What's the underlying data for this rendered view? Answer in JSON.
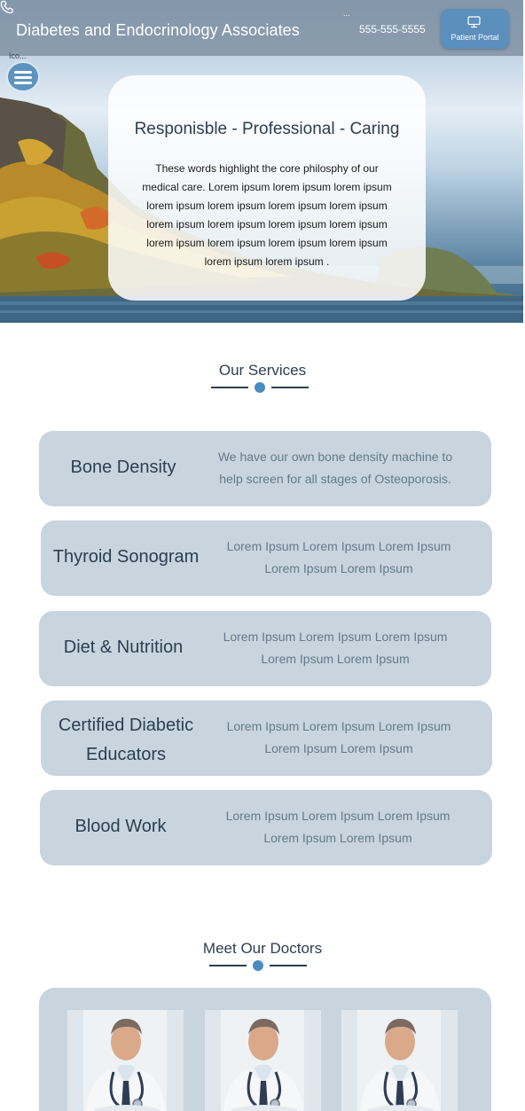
{
  "header": {
    "site_title": "Diabetes and Endocrinology Associates",
    "phone_dots": "...",
    "phone_icon": "phone-icon",
    "phone": "555-555-5555",
    "portal_dots": "...",
    "portal_icon": "monitor-icon",
    "portal_label": "Patient Portal",
    "icon_label": "Ico...",
    "menu_icon": "hamburger-menu-icon"
  },
  "hero": {
    "heading": "Responisble - Professional - Caring",
    "text": "These words highlight the core philosphy of our medical care.  Lorem ipsum lorem ipsum lorem ipsum lorem ipsum lorem ipsum lorem ipsum lorem ipsum lorem ipsum lorem ipsum lorem ipsum lorem ipsum lorem ipsum lorem ipsum lorem ipsum lorem ipsum lorem ipsum lorem ipsum ."
  },
  "services": {
    "title": "Our Services",
    "items": [
      {
        "name": "Bone Density",
        "desc": "We have our own bone density machine to help screen for all stages of Osteoporosis."
      },
      {
        "name": "Thyroid Sonogram",
        "desc": "Lorem Ipsum Lorem Ipsum Lorem Ipsum Lorem Ipsum Lorem Ipsum"
      },
      {
        "name": "Diet & Nutrition",
        "desc": "Lorem Ipsum Lorem Ipsum Lorem Ipsum Lorem Ipsum Lorem Ipsum"
      },
      {
        "name": "Certified Diabetic Educators",
        "desc": "Lorem Ipsum Lorem Ipsum Lorem Ipsum Lorem Ipsum Lorem Ipsum"
      },
      {
        "name": "Blood Work",
        "desc": "Lorem Ipsum Lorem Ipsum Lorem Ipsum Lorem Ipsum Lorem Ipsum"
      }
    ]
  },
  "doctors": {
    "title": "Meet Our Doctors",
    "photo_count_visible": 3
  },
  "colors": {
    "accent": "#4a8cc0",
    "card": "#c8d5de",
    "heading": "#2d3e50",
    "portal_button": "#5b8fbc"
  }
}
